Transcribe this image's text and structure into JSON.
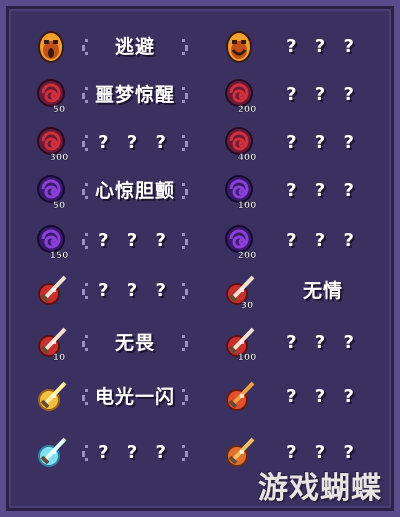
{
  "achievements": [
    [
      {
        "icon": "gold-mask-icon",
        "label": "逃避",
        "colors": [
          "#f0a030",
          "#c05018",
          "#3a1a10"
        ]
      },
      {
        "icon": "gold-mask-smiling-icon",
        "label": "? ? ?",
        "colors": [
          "#f0a030",
          "#c05018",
          "#3a1a10"
        ]
      }
    ],
    [
      {
        "icon": "red-swirl-orb-50-icon",
        "label": "噩梦惊醒",
        "colors": [
          "#d0303a",
          "#6a1a3a",
          "#2a0a20"
        ],
        "badge": "50"
      },
      {
        "icon": "red-swirl-orb-200-icon",
        "label": "? ? ?",
        "colors": [
          "#d0303a",
          "#6a1a3a",
          "#2a0a20"
        ],
        "badge": "200"
      }
    ],
    [
      {
        "icon": "red-swirl-orb-300-icon",
        "label": "? ? ?",
        "colors": [
          "#d0303a",
          "#6a1a3a",
          "#2a0a20"
        ],
        "badge": "300"
      },
      {
        "icon": "red-swirl-orb-400-icon",
        "label": "? ? ?",
        "colors": [
          "#d0303a",
          "#6a1a3a",
          "#2a0a20"
        ],
        "badge": "400"
      }
    ],
    [
      {
        "icon": "purple-swirl-orb-50-icon",
        "label": "心惊胆颤",
        "colors": [
          "#8a40d8",
          "#3a1a6a",
          "#160a30"
        ],
        "badge": "50"
      },
      {
        "icon": "purple-swirl-orb-100-icon",
        "label": "? ? ?",
        "colors": [
          "#8a40d8",
          "#3a1a6a",
          "#160a30"
        ],
        "badge": "100"
      }
    ],
    [
      {
        "icon": "purple-swirl-orb-150-icon",
        "label": "? ? ?",
        "colors": [
          "#8a40d8",
          "#3a1a6a",
          "#160a30"
        ],
        "badge": "150"
      },
      {
        "icon": "purple-swirl-orb-200-icon",
        "label": "? ? ?",
        "colors": [
          "#8a40d8",
          "#3a1a6a",
          "#160a30"
        ],
        "badge": "200"
      }
    ],
    [
      {
        "icon": "red-dagger-orb-icon",
        "label": "? ? ?",
        "colors": [
          "#c83030",
          "#f0e0d0",
          "#5a1010"
        ]
      },
      {
        "icon": "red-dagger-orb-30-icon",
        "label": "无情",
        "colors": [
          "#c83030",
          "#f0e0d0",
          "#5a1010"
        ],
        "badge": "30"
      }
    ],
    [
      {
        "icon": "red-dagger-orb-10-icon",
        "label": "无畏",
        "colors": [
          "#c83030",
          "#f0e0d0",
          "#5a1010"
        ],
        "badge": "10"
      },
      {
        "icon": "red-dagger-orb-100-icon",
        "label": "? ? ?",
        "colors": [
          "#c83030",
          "#f0e0d0",
          "#5a1010"
        ],
        "badge": "100"
      }
    ],
    [
      {
        "icon": "gold-lightning-dagger-icon",
        "label": "电光一闪",
        "colors": [
          "#f0c040",
          "#fff0a0",
          "#a06010"
        ]
      },
      {
        "icon": "fire-dagger-icon",
        "label": "? ? ?",
        "colors": [
          "#e05030",
          "#f0a040",
          "#6a1a10"
        ]
      }
    ],
    [
      {
        "icon": "ice-crystal-dagger-icon",
        "label": "? ? ?",
        "colors": [
          "#80e0f0",
          "#e0ffff",
          "#3080a0"
        ]
      },
      {
        "icon": "orange-fire-dagger-icon",
        "label": "? ? ?",
        "colors": [
          "#e07030",
          "#f0c060",
          "#6a2a10"
        ]
      }
    ]
  ],
  "watermark": "游戏蝴蝶",
  "theme": {
    "panel": "#3b3160",
    "border": "#5a4c8c",
    "bracket": "#9b8fc8",
    "text": "#ffffff"
  }
}
